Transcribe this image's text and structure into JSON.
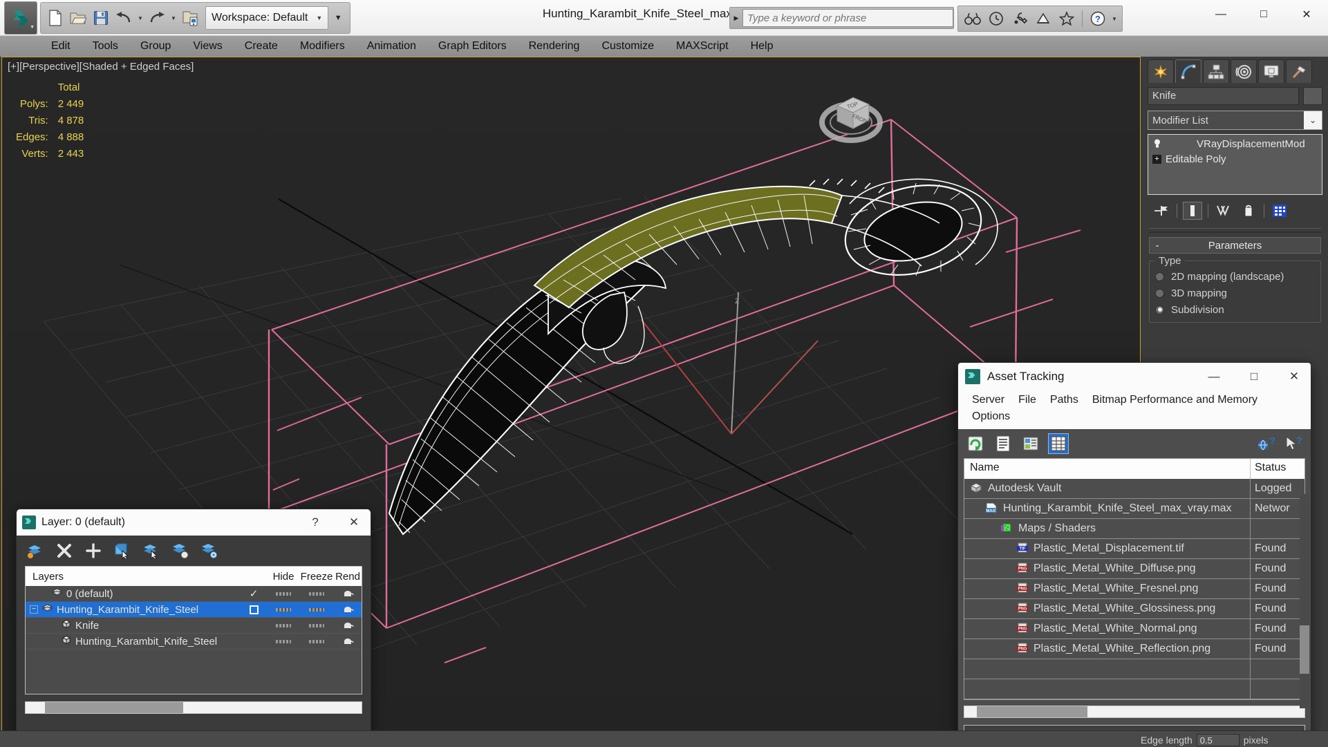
{
  "app": {
    "document_title": "Hunting_Karambit_Knife_Steel_max_vray.max",
    "workspace_label": "Workspace: Default",
    "search_placeholder": "Type a keyword or phrase"
  },
  "window_controls": {
    "minimize": "—",
    "maximize": "□",
    "close": "✕"
  },
  "menubar": {
    "items": [
      "Edit",
      "Tools",
      "Group",
      "Views",
      "Create",
      "Modifiers",
      "Animation",
      "Graph Editors",
      "Rendering",
      "Customize",
      "MAXScript",
      "Help"
    ]
  },
  "viewport": {
    "label": "[+][Perspective][Shaded + Edged Faces]",
    "stats_header": "Total",
    "stats": [
      {
        "label": "Polys:",
        "value": "2 449"
      },
      {
        "label": "Tris:",
        "value": "4 878"
      },
      {
        "label": "Edges:",
        "value": "4 888"
      },
      {
        "label": "Verts:",
        "value": "2 443"
      }
    ],
    "viewcube_faces": {
      "top": "TOP",
      "front": "FRONT"
    }
  },
  "command_panel": {
    "tabs": [
      "create-tab",
      "modify-tab",
      "hierarchy-tab",
      "motion-tab",
      "display-tab",
      "utilities-tab"
    ],
    "active_tab_index": 1,
    "object_name": "Knife",
    "modifier_list_label": "Modifier List",
    "modifier_stack": [
      {
        "name": "VRayDisplacementMod",
        "icon": "lightbulb-icon",
        "indent": 1
      },
      {
        "name": "Editable Poly",
        "icon": "plus-box-icon",
        "indent": 0
      }
    ],
    "rollout": {
      "collapse_sign": "-",
      "title": "Parameters",
      "group_title": "Type",
      "options": [
        {
          "label": "2D mapping (landscape)",
          "selected": false
        },
        {
          "label": "3D mapping",
          "selected": false
        },
        {
          "label": "Subdivision",
          "selected": true
        }
      ]
    }
  },
  "layer_dialog": {
    "title": "Layer: 0 (default)",
    "help_label": "?",
    "close_label": "✕",
    "toolbar": [
      "set-current-layer-icon",
      "delete-layer-icon",
      "new-layer-icon",
      "add-selection-to-layer-icon",
      "select-objects-in-layer-icon",
      "select-highlighted-objects-icon",
      "layer-properties-icon"
    ],
    "columns": {
      "name": "Layers",
      "current": "",
      "hide": "Hide",
      "freeze": "Freeze",
      "render": "Rend"
    },
    "rows": [
      {
        "name": "0 (default)",
        "icon": "layer-icon",
        "indent": 1,
        "current": "check",
        "selected": false,
        "expander": ""
      },
      {
        "name": "Hunting_Karambit_Knife_Steel",
        "icon": "layer-icon",
        "indent": 0,
        "current": "box",
        "selected": true,
        "expander": "minus"
      },
      {
        "name": "Knife",
        "icon": "object-icon",
        "indent": 2,
        "current": "",
        "selected": false,
        "expander": ""
      },
      {
        "name": "Hunting_Karambit_Knife_Steel",
        "icon": "object-icon",
        "indent": 2,
        "current": "",
        "selected": false,
        "expander": ""
      }
    ]
  },
  "asset_tracking": {
    "title": "Asset Tracking",
    "menu": [
      "Server",
      "File",
      "Paths",
      "Bitmap Performance and Memory",
      "Options"
    ],
    "toolbar": [
      "refresh-icon",
      "list-view-icon",
      "details-view-icon",
      "grid-view-icon"
    ],
    "toolbar_right": [
      "help-icon",
      "context-help-icon"
    ],
    "active_tool_index": 3,
    "columns": {
      "name": "Name",
      "status": "Status"
    },
    "rows": [
      {
        "name": "Autodesk Vault",
        "status": "Logged",
        "icon": "vault-icon",
        "indent": 0
      },
      {
        "name": "Hunting_Karambit_Knife_Steel_max_vray.max",
        "status": "Networ",
        "icon": "max-file-icon",
        "indent": 1
      },
      {
        "name": "Maps / Shaders",
        "status": "",
        "icon": "maps-icon",
        "indent": 2
      },
      {
        "name": "Plastic_Metal_Displacement.tif",
        "status": "Found",
        "icon": "tif-file-icon",
        "indent": 3
      },
      {
        "name": "Plastic_Metal_White_Diffuse.png",
        "status": "Found",
        "icon": "png-file-icon",
        "indent": 3
      },
      {
        "name": "Plastic_Metal_White_Fresnel.png",
        "status": "Found",
        "icon": "png-file-icon",
        "indent": 3
      },
      {
        "name": "Plastic_Metal_White_Glossiness.png",
        "status": "Found",
        "icon": "png-file-icon",
        "indent": 3
      },
      {
        "name": "Plastic_Metal_White_Normal.png",
        "status": "Found",
        "icon": "png-file-icon",
        "indent": 3
      },
      {
        "name": "Plastic_Metal_White_Reflection.png",
        "status": "Found",
        "icon": "png-file-icon",
        "indent": 3
      },
      {
        "name": "",
        "status": "",
        "icon": "",
        "indent": 0
      },
      {
        "name": "",
        "status": "",
        "icon": "",
        "indent": 0
      }
    ]
  },
  "statusbar": {
    "edge_length_label": "Edge length",
    "edge_length_value": "0.5",
    "edge_length_unit": "pixels"
  },
  "colors": {
    "accent_blue": "#1f6fd4",
    "viewport_bg": "#262626",
    "stats_yellow": "#e8d24a",
    "gizmo_pink": "#e06e9a",
    "selected_green": "#6b6f1f"
  }
}
